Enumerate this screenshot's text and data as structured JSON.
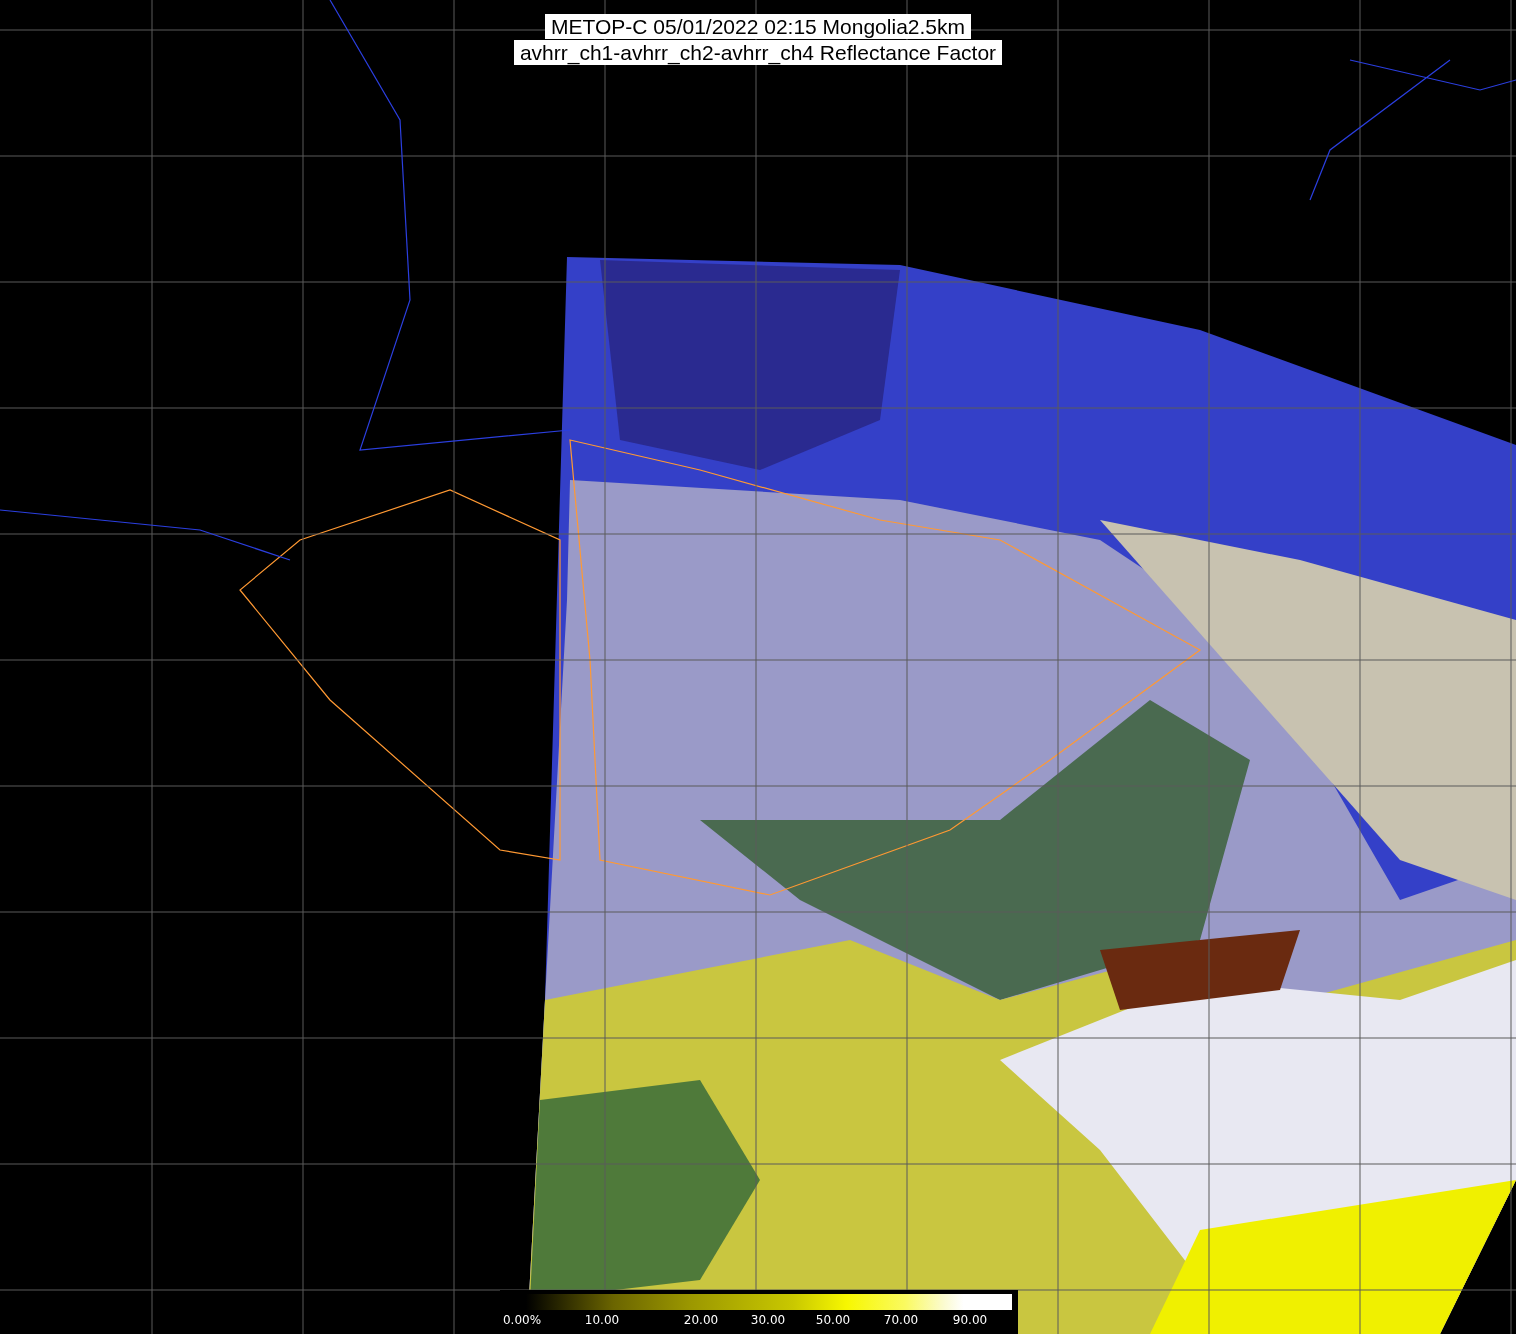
{
  "title": {
    "line_1": "METOP-C 05/01/2022 02:15 Mongolia2.5km",
    "line_2": "avhrr_ch1-avhrr_ch2-avhrr_ch4 Reflectance Factor"
  },
  "colorbar": {
    "tick_labels": [
      "0.00%",
      "10.00",
      "20.00",
      "30.00",
      "50.00",
      "70.00",
      "90.00"
    ]
  }
}
